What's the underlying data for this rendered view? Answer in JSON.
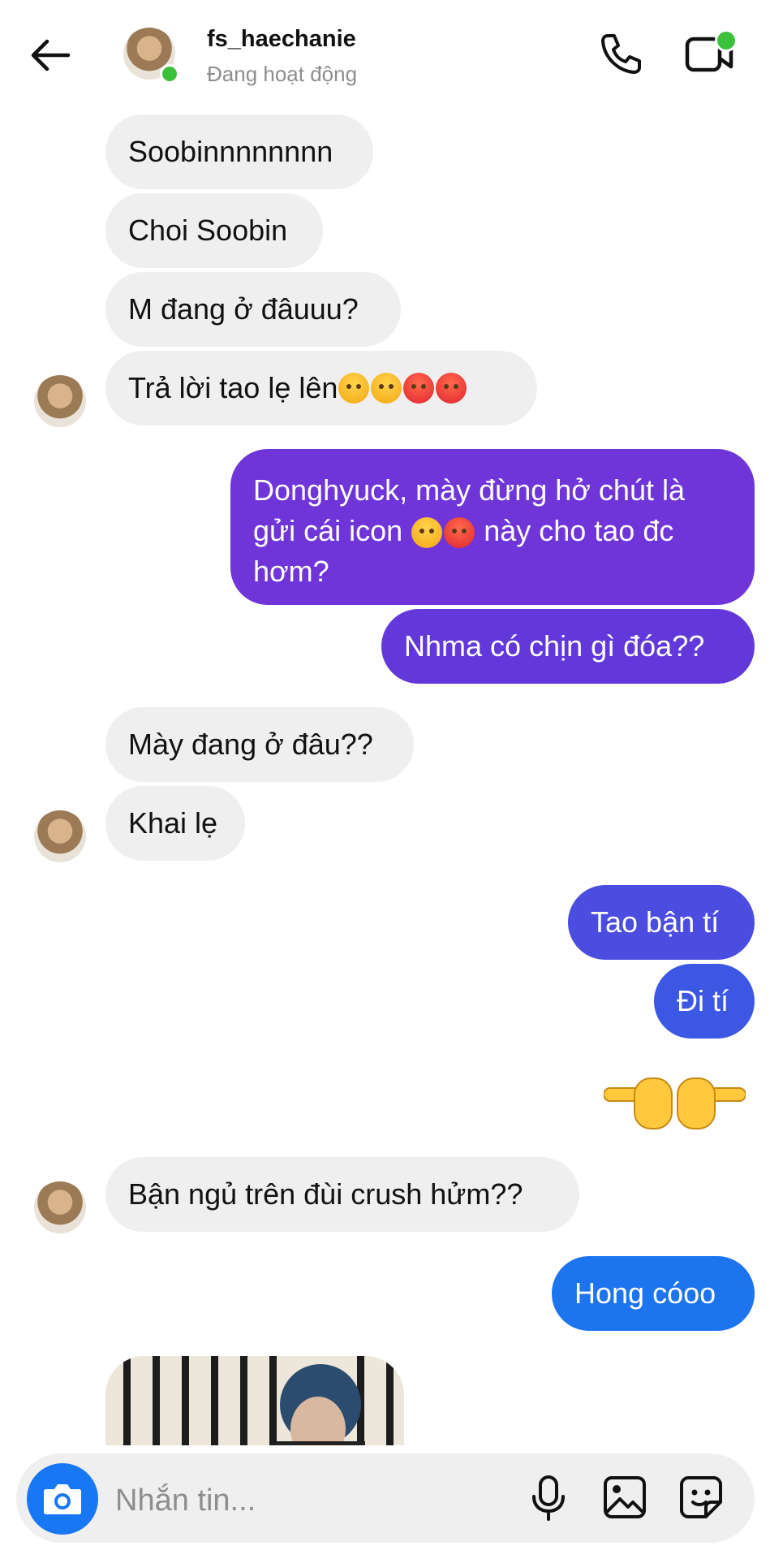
{
  "header": {
    "username": "fs_haechanie",
    "status": "Đang hoạt động"
  },
  "messages": [
    {
      "dir": "in",
      "text": "Soobinnnnnnnn"
    },
    {
      "dir": "in",
      "text": "Choi Soobin"
    },
    {
      "dir": "in",
      "text": "M đang ở đâuuu?"
    },
    {
      "dir": "in",
      "text_before": "Trả lời tao lẹ lên ",
      "emoji": [
        "angry-emoji",
        "angry-emoji",
        "rage-emoji",
        "rage-emoji"
      ]
    },
    {
      "dir": "out",
      "line1": "Donghyuck, mày đừng hở chút là",
      "line2_before": "gửi cái icon ",
      "line2_emoji": [
        "angry-emoji",
        "rage-emoji"
      ],
      "line2_after": " này cho tao đc",
      "line3": "hơm?"
    },
    {
      "dir": "out",
      "text": "Nhma có chịn gì đóa??"
    },
    {
      "dir": "in",
      "text": "Mày đang ở đâu??"
    },
    {
      "dir": "in",
      "text": "Khai lẹ"
    },
    {
      "dir": "out",
      "text": "Tao bận tí"
    },
    {
      "dir": "out",
      "text": "Đi tí"
    },
    {
      "dir": "out",
      "emoji": [
        "pointing-left-hand",
        "pointing-right-hand"
      ]
    },
    {
      "dir": "in",
      "text": "Bận ngủ trên đùi crush hửm??"
    },
    {
      "dir": "out",
      "text": "Hong cóoo"
    },
    {
      "dir": "in",
      "type": "photo"
    }
  ],
  "composer": {
    "placeholder": "Nhắn tin..."
  },
  "colors": {
    "incoming_bg": "#efefef",
    "outgoing_purple": "#7b32d6",
    "outgoing_indigo": "#5a49e0",
    "outgoing_blue": "#1c74ee",
    "online_green": "#3cc13b",
    "camera_blue": "#1877f2"
  }
}
